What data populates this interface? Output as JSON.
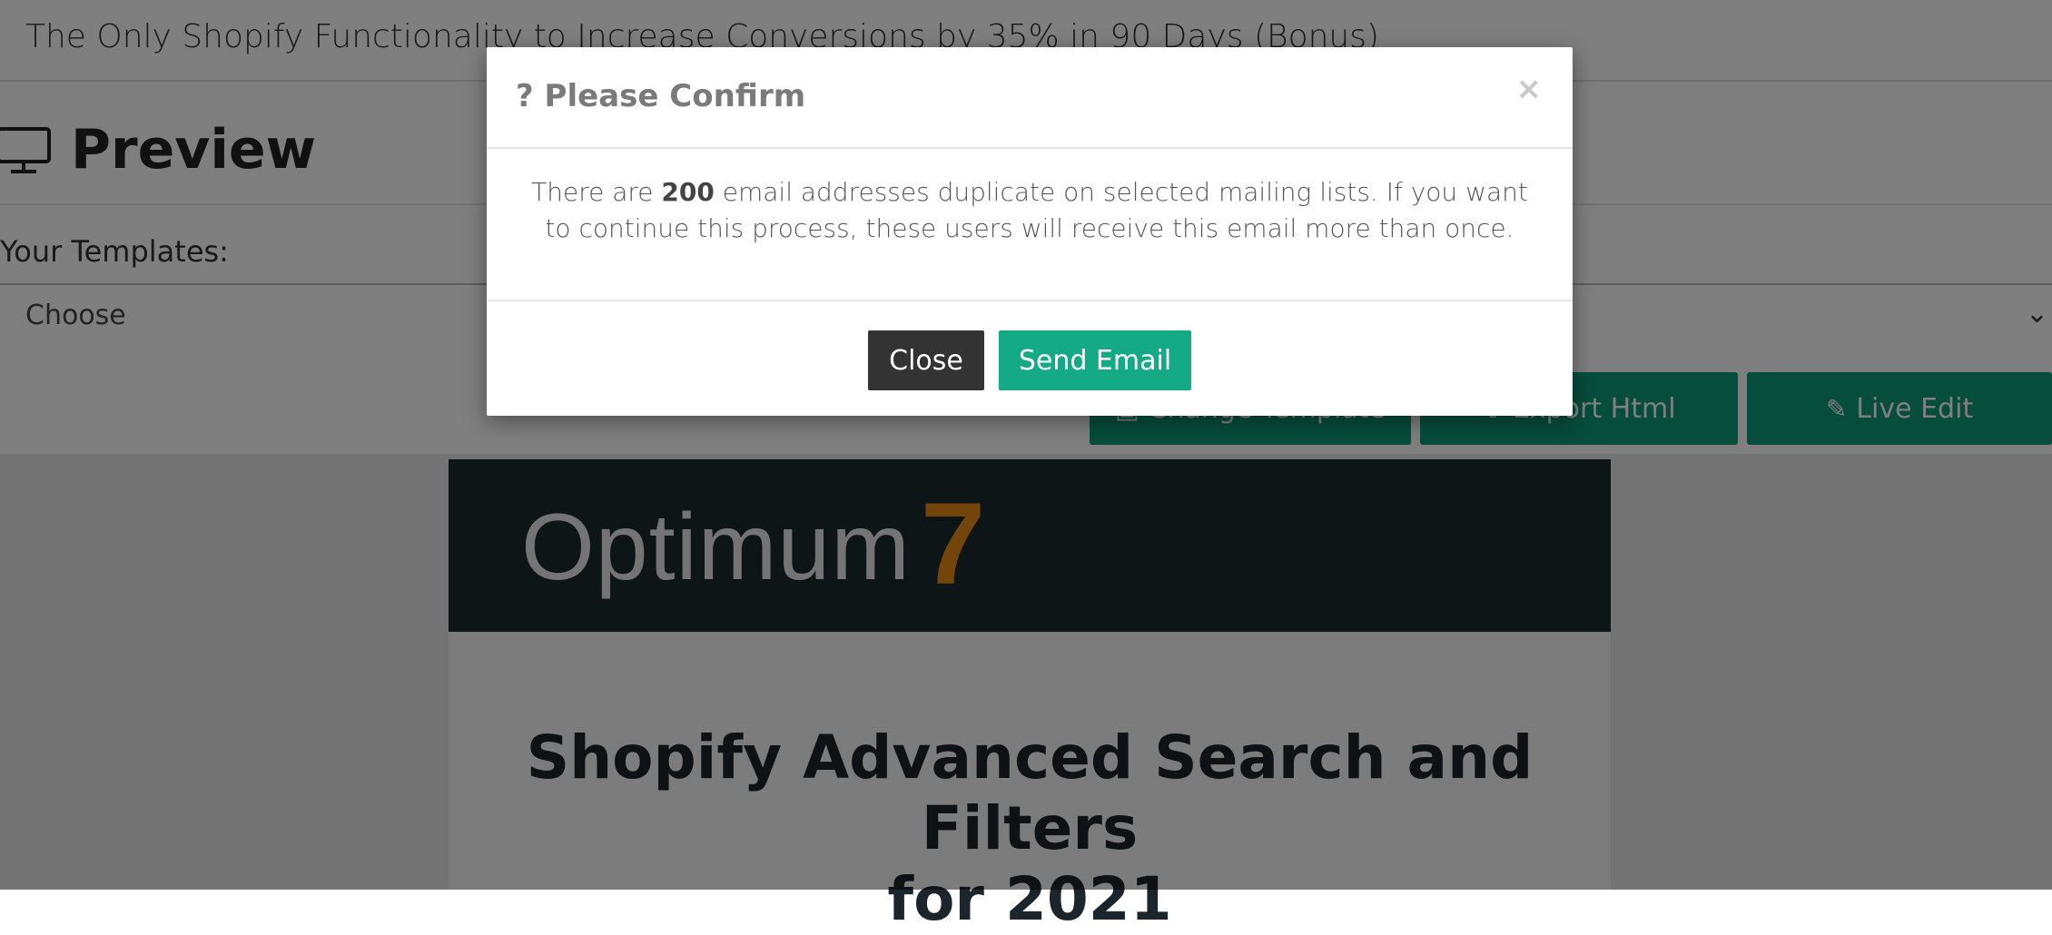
{
  "page": {
    "subject": "The Only Shopify Functionality to Increase Conversions by 35% in 90 Days (Bonus)",
    "preview_title": "Preview",
    "templates_label": "Your Templates:",
    "template_select": {
      "value": "Choose"
    }
  },
  "toolbar": {
    "buttons": [
      {
        "label": "Change Template",
        "icon": "image-icon"
      },
      {
        "label": "Export Html",
        "icon": "export-icon"
      },
      {
        "label": "Live Edit",
        "icon": "edit-icon"
      }
    ]
  },
  "email_preview": {
    "logo_word": "Optimum",
    "logo_number": "7",
    "heading_line1": "Shopify Advanced Search and Filters",
    "heading_line2": "for 2021"
  },
  "modal": {
    "title": "? Please Confirm",
    "close_x": "×",
    "message_pre": "There are ",
    "message_count": "200",
    "message_post": " email addresses duplicate on selected mailing lists. If you want to continue this process, these users will receive this email more than once.",
    "close_button": "Close",
    "send_button": "Send Email"
  },
  "colors": {
    "accent_green": "#15aa86",
    "toolbar_green": "#0f9a78",
    "dark_button": "#333333",
    "banner": "#1a2a2e",
    "logo_orange": "#e88b17"
  }
}
